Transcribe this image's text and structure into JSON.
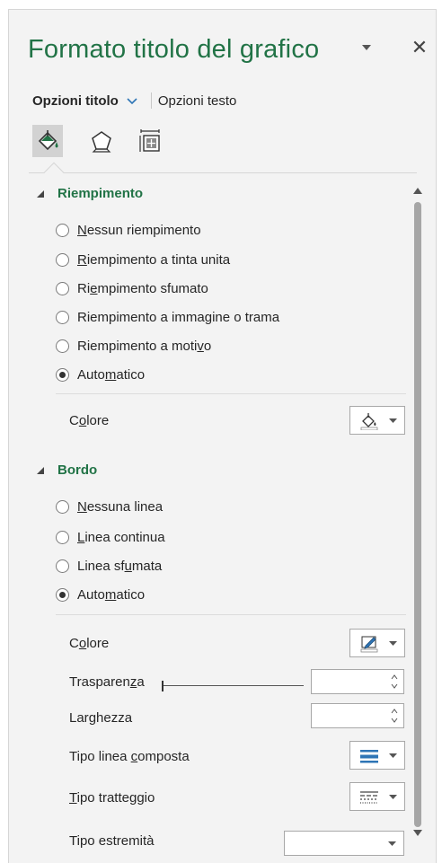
{
  "header": {
    "title": "Formato titolo del grafico",
    "dropdown_icon": "triangle-down-icon",
    "close_icon": "close-icon"
  },
  "tabs": [
    {
      "label": "Opzioni titolo",
      "active": true
    },
    {
      "label": "Opzioni testo",
      "active": false
    }
  ],
  "categories": [
    {
      "name": "fill-line-icon",
      "selected": true
    },
    {
      "name": "effects-icon",
      "selected": false
    },
    {
      "name": "size-properties-icon",
      "selected": false
    }
  ],
  "fill_section": {
    "title": "Riempimento",
    "options": [
      {
        "pre": "",
        "u": "N",
        "post": "essun riempimento",
        "checked": false
      },
      {
        "pre": "",
        "u": "R",
        "post": "iempimento a tinta unita",
        "checked": false
      },
      {
        "pre": "Ri",
        "u": "e",
        "post": "mpimento sfumato",
        "checked": false
      },
      {
        "pre": "Riempimento a imma",
        "u": "g",
        "post": "ine o trama",
        "checked": false
      },
      {
        "pre": "Riempimento a moti",
        "u": "v",
        "post": "o",
        "checked": false
      },
      {
        "pre": "Auto",
        "u": "m",
        "post": "atico",
        "checked": true
      }
    ],
    "color_label": {
      "pre": "C",
      "u": "o",
      "post": "lore"
    }
  },
  "border_section": {
    "title": "Bordo",
    "options": [
      {
        "pre": "",
        "u": "N",
        "post": "essuna linea",
        "checked": false
      },
      {
        "pre": "",
        "u": "L",
        "post": "inea continua",
        "checked": false
      },
      {
        "pre": "Linea sf",
        "u": "u",
        "post": "mata",
        "checked": false
      },
      {
        "pre": "Auto",
        "u": "m",
        "post": "atico",
        "checked": true
      }
    ],
    "fields": {
      "color": {
        "pre": "C",
        "u": "o",
        "post": "lore"
      },
      "transparency": {
        "pre": "Trasparen",
        "u": "z",
        "post": "a",
        "value": ""
      },
      "width": {
        "pre": "Lar",
        "u": "g",
        "post": "hezza",
        "value": ""
      },
      "compound": {
        "pre": "Tipo linea ",
        "u": "c",
        "post": "omposta"
      },
      "dash": {
        "pre": "",
        "u": "T",
        "post": "ipo tratteggio"
      },
      "cap": {
        "pre": "Tipo estremità",
        "u": "",
        "post": "",
        "value": ""
      }
    }
  },
  "colors": {
    "accent_green": "#217346",
    "pane_bg": "#f3f3f3",
    "selected_icon_bg": "#d2d2d2",
    "pen_blue": "#2e75b6"
  },
  "transparency_level": 0
}
